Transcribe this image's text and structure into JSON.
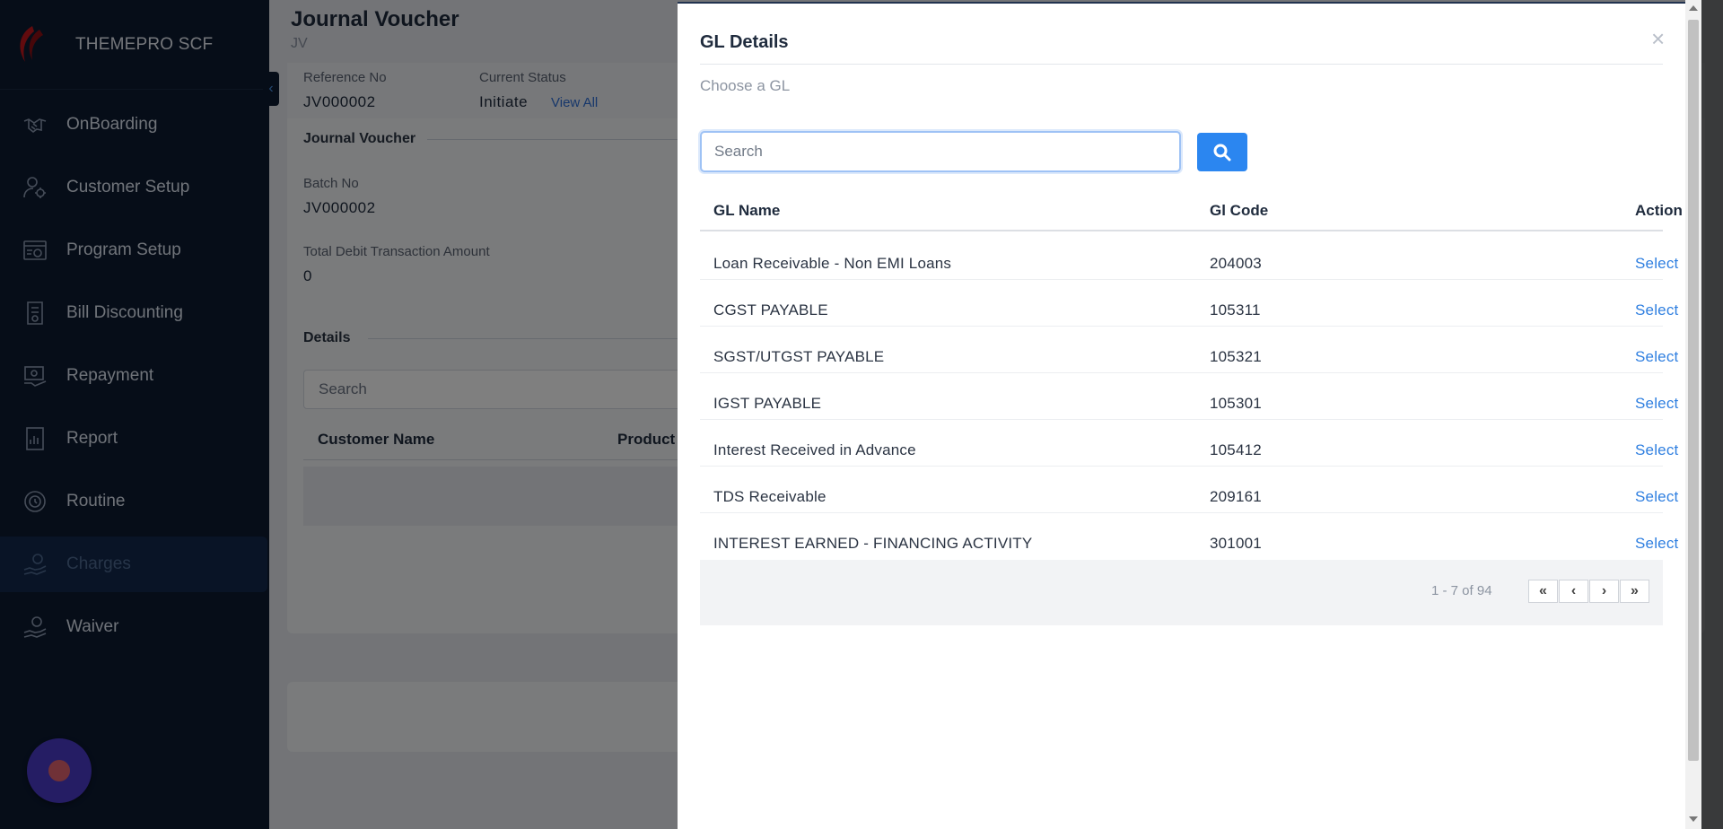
{
  "sidebar": {
    "brand": "THEMEPRO SCF",
    "items": [
      {
        "label": "OnBoarding",
        "icon": "handshake-icon"
      },
      {
        "label": "Customer Setup",
        "icon": "user-gear-icon"
      },
      {
        "label": "Program Setup",
        "icon": "program-icon"
      },
      {
        "label": "Bill Discounting",
        "icon": "bill-icon"
      },
      {
        "label": "Repayment",
        "icon": "repayment-icon"
      },
      {
        "label": "Report",
        "icon": "report-icon"
      },
      {
        "label": "Routine",
        "icon": "routine-icon"
      },
      {
        "label": "Charges",
        "icon": "charges-icon",
        "active": true
      },
      {
        "label": "Waiver",
        "icon": "waiver-icon"
      }
    ]
  },
  "page": {
    "title": "Journal Voucher",
    "subtitle": "JV",
    "reference_label": "Reference No",
    "reference_value": "JV000002",
    "status_label": "Current Status",
    "status_value": "Initiate",
    "view_all": "View All",
    "section_title": "Journal Voucher",
    "batch_label": "Batch No",
    "batch_value": "JV000002",
    "debit_label": "Total Debit Transaction Amount",
    "debit_value": "0",
    "details_title": "Details",
    "details_search_placeholder": "Search",
    "col_customer": "Customer Name",
    "col_product": "Product"
  },
  "modal": {
    "title": "GL Details",
    "close": "×",
    "hint": "Choose a GL",
    "search_placeholder": "Search",
    "columns": {
      "name": "GL Name",
      "code": "Gl Code",
      "action": "Action"
    },
    "rows": [
      {
        "name": "Loan Receivable - Non EMI Loans",
        "code": "204003",
        "action": "Select"
      },
      {
        "name": "CGST PAYABLE",
        "code": "105311",
        "action": "Select"
      },
      {
        "name": "SGST/UTGST PAYABLE",
        "code": "105321",
        "action": "Select"
      },
      {
        "name": "IGST PAYABLE",
        "code": "105301",
        "action": "Select"
      },
      {
        "name": "Interest Received in Advance",
        "code": "105412",
        "action": "Select"
      },
      {
        "name": "TDS Receivable",
        "code": "209161",
        "action": "Select"
      },
      {
        "name": "INTEREST EARNED - FINANCING ACTIVITY",
        "code": "301001",
        "action": "Select"
      }
    ],
    "pagination": {
      "text": "1 - 7 of 94",
      "first": "«",
      "prev": "‹",
      "next": "›",
      "last": "»"
    }
  },
  "colors": {
    "sidebar_bg": "#0c1a31",
    "accent": "#2b86f0",
    "link": "#2f7fe0",
    "fab": "#4b3ac8"
  }
}
